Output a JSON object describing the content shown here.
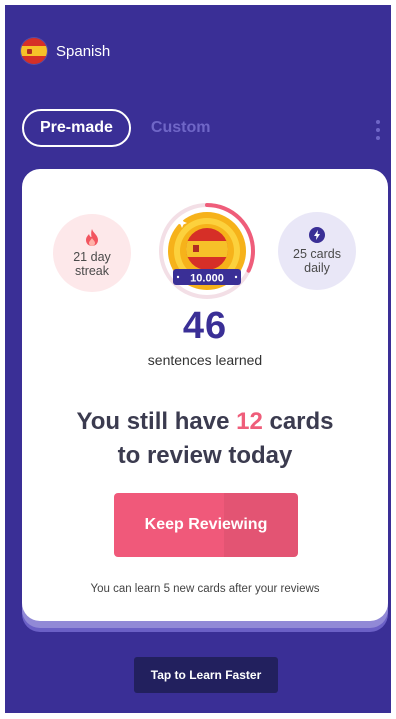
{
  "header": {
    "language": "Spanish",
    "flag_icon": "spain-flag-icon"
  },
  "tabs": [
    {
      "label": "Pre-made",
      "active": true
    },
    {
      "label": "Custom",
      "active": false
    }
  ],
  "menu_icon": "more-vertical-icon",
  "stats": {
    "streak": {
      "icon": "flame-icon",
      "line1": "21 day",
      "line2": "streak"
    },
    "daily": {
      "icon": "lightning-icon",
      "line1": "25 cards",
      "line2": "daily"
    },
    "badge_label": "10.000",
    "badge_progress": 0.32
  },
  "sentences": {
    "count": "46",
    "label": "sentences learned"
  },
  "headline": {
    "prefix": "You still have ",
    "count": "12",
    "suffix": " cards",
    "line2": "to review today"
  },
  "primary_button": "Keep Reviewing",
  "note": "You can learn 5 new cards after your reviews",
  "footer_button": "Tap to Learn Faster",
  "colors": {
    "background": "#3a2f96",
    "accent": "#f0597a",
    "number": "#3a2f96",
    "footer_button": "#22205e"
  }
}
